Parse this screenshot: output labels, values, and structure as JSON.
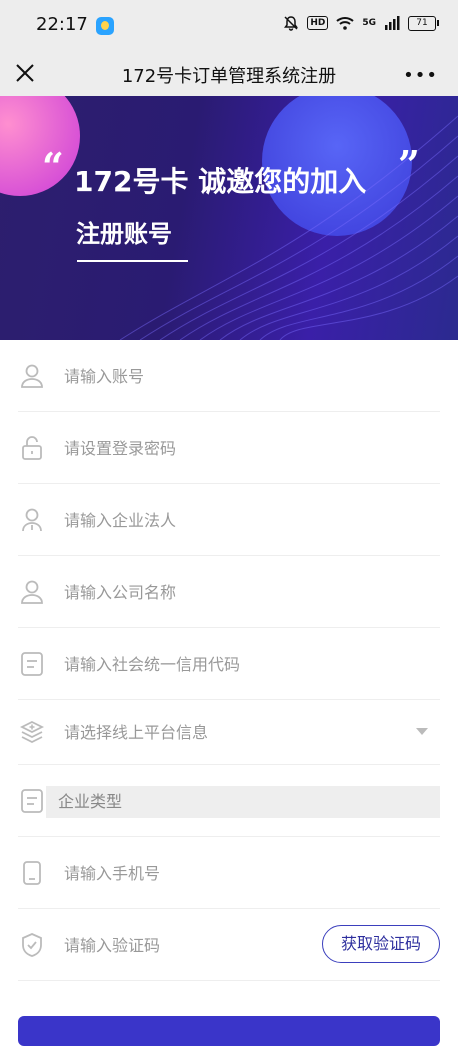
{
  "status_bar": {
    "time": "22:17",
    "hd_label": "HD",
    "signal_label": "5G",
    "battery": "71"
  },
  "nav": {
    "title": "172号卡订单管理系统注册",
    "more": "•••"
  },
  "banner": {
    "quote_open": "“",
    "quote_close": "”",
    "headline": "172号卡 诚邀您的加入",
    "subtitle": "注册账号"
  },
  "form": {
    "account_placeholder": "请输入账号",
    "password_placeholder": "请设置登录密码",
    "legal_person_placeholder": "请输入企业法人",
    "company_placeholder": "请输入公司名称",
    "credit_code_placeholder": "请输入社会统一信用代码",
    "platform_select": "请选择线上平台信息",
    "enterprise_type": "企业类型",
    "phone_placeholder": "请输入手机号",
    "code_placeholder": "请输入验证码",
    "get_code_button": "获取验证码"
  },
  "colors": {
    "banner_bg": "#2a1b72",
    "accent": "#3a35c9",
    "statusbar_bg": "#ededed"
  }
}
